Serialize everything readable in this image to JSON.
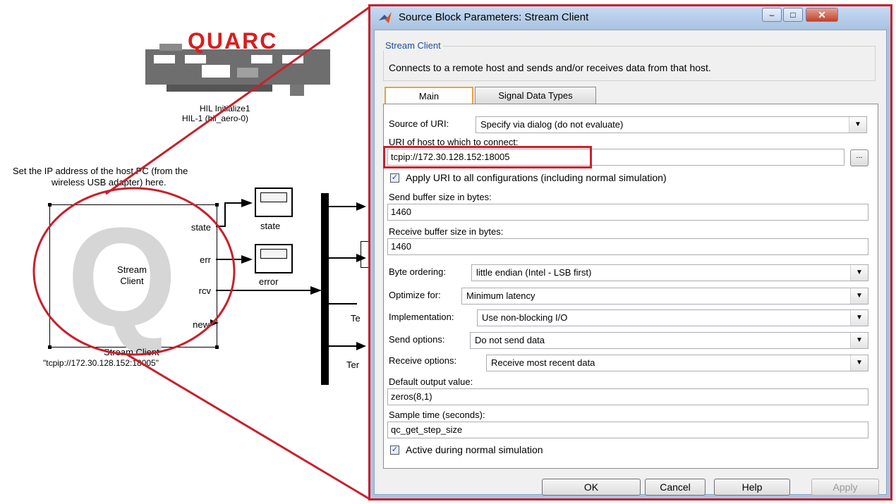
{
  "canvas": {
    "hil_logo_text": "QUARC",
    "hil_block_name": "HIL Initialize1",
    "hil_block_sub": "HIL-1 (hil_aero-0)",
    "note_line1": "Set the IP address of the host PC (from the",
    "note_line2": "wireless USB adapter) here.",
    "stream_block_label_line1": "Stream",
    "stream_block_label_line2": "Client",
    "stream_block_name": "Stream Client",
    "stream_block_param": "\"tcpip://172.30.128.152:18005\"",
    "ports": {
      "state": "state",
      "err": "err",
      "rcv": "rcv",
      "new": "new"
    },
    "scope_state_label": "state",
    "scope_error_label": "error",
    "partial_label_1": "Te",
    "partial_label_2": "Ter"
  },
  "dialog": {
    "title": "Source Block Parameters: Stream Client",
    "group_title": "Stream Client",
    "description": "Connects to a remote host and sends and/or receives data from that host.",
    "tabs": [
      "Main",
      "Signal Data Types"
    ],
    "active_tab": "Main",
    "source_uri_label": "Source of URI:",
    "source_uri_value": "Specify via dialog (do not evaluate)",
    "uri_label": "URI of host to which to connect:",
    "uri_value": "tcpip://172.30.128.152:18005",
    "browse_label": "...",
    "apply_uri_label": "Apply URI to all configurations (including normal simulation)",
    "apply_uri_checked": true,
    "send_buffer_label": "Send buffer size in bytes:",
    "send_buffer_value": "1460",
    "receive_buffer_label": "Receive buffer size in bytes:",
    "receive_buffer_value": "1460",
    "byte_ordering_label": "Byte ordering:",
    "byte_ordering_value": "little endian (Intel - LSB first)",
    "optimize_label": "Optimize for:",
    "optimize_value": "Minimum latency",
    "implementation_label": "Implementation:",
    "implementation_value": "Use non-blocking I/O",
    "send_options_label": "Send options:",
    "send_options_value": "Do not send data",
    "receive_options_label": "Receive options:",
    "receive_options_value": "Receive most recent data",
    "default_output_label": "Default output value:",
    "default_output_value": "zeros(8,1)",
    "sample_time_label": "Sample time (seconds):",
    "sample_time_value": "qc_get_step_size",
    "active_normal_label": "Active during normal simulation",
    "active_normal_checked": true,
    "buttons": {
      "ok": "OK",
      "cancel": "Cancel",
      "help": "Help",
      "apply": "Apply"
    }
  },
  "annotation_color": "#c8202c"
}
